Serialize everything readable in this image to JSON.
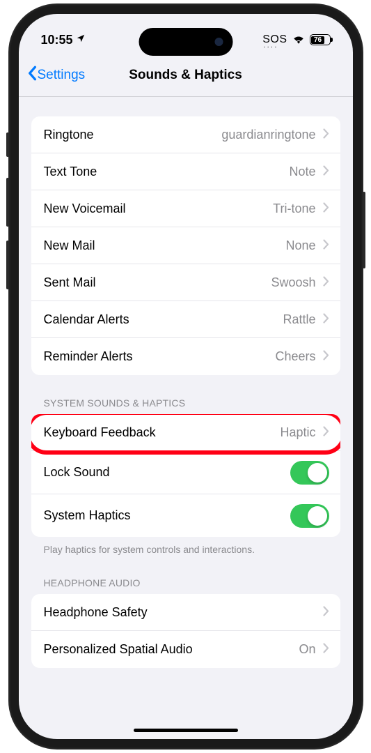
{
  "statusBar": {
    "time": "10:55",
    "sos": "SOS",
    "battery": "76"
  },
  "nav": {
    "back": "Settings",
    "title": "Sounds & Haptics"
  },
  "sounds": {
    "ringtone": {
      "label": "Ringtone",
      "value": "guardianringtone"
    },
    "textTone": {
      "label": "Text Tone",
      "value": "Note"
    },
    "voicemail": {
      "label": "New Voicemail",
      "value": "Tri-tone"
    },
    "newMail": {
      "label": "New Mail",
      "value": "None"
    },
    "sentMail": {
      "label": "Sent Mail",
      "value": "Swoosh"
    },
    "calendar": {
      "label": "Calendar Alerts",
      "value": "Rattle"
    },
    "reminder": {
      "label": "Reminder Alerts",
      "value": "Cheers"
    }
  },
  "systemHeader": "SYSTEM SOUNDS & HAPTICS",
  "system": {
    "keyboard": {
      "label": "Keyboard Feedback",
      "value": "Haptic"
    },
    "lock": {
      "label": "Lock Sound",
      "on": true
    },
    "haptics": {
      "label": "System Haptics",
      "on": true
    }
  },
  "systemFooter": "Play haptics for system controls and interactions.",
  "headphoneHeader": "HEADPHONE AUDIO",
  "headphone": {
    "safety": {
      "label": "Headphone Safety",
      "value": ""
    },
    "spatial": {
      "label": "Personalized Spatial Audio",
      "value": "On"
    }
  }
}
